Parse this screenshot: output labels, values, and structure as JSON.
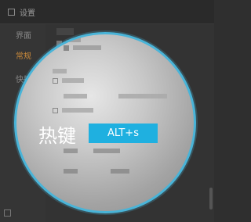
{
  "window": {
    "title": "设置"
  },
  "sidebar": {
    "items": [
      {
        "label": "界面",
        "active": false
      },
      {
        "label": "常规",
        "active": true
      },
      {
        "label": "快捷键",
        "active": false
      }
    ]
  },
  "main": {
    "hotkey_label": "热键",
    "hotkey_value": "ALT+s"
  },
  "colors": {
    "accent": "#1fb0e0",
    "ring": "#49b4d8",
    "active": "#c9893a"
  }
}
